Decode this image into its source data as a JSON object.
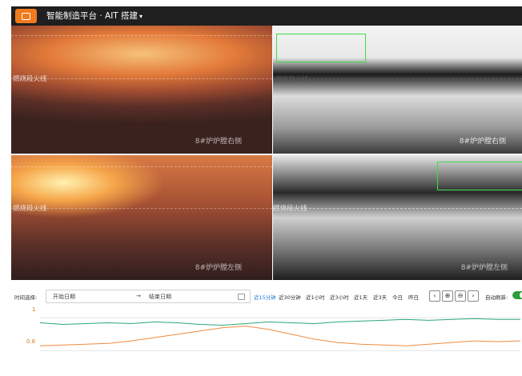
{
  "header": {
    "title": "智能制造平台 · AIT 搭建",
    "dropdown_caret": "▾",
    "logo_icon": "platform-logo"
  },
  "panels": {
    "top_left": {
      "zone_label": "燃烧段火线",
      "camera_label": "8#炉炉膛右侧"
    },
    "top_right": {
      "zone_label": "燃烧段火线",
      "camera_label": "8#炉炉膛右侧"
    },
    "bottom_left": {
      "zone_label": "燃烧段火线",
      "camera_label": "8#炉炉膛左侧"
    },
    "bottom_right": {
      "zone_label": "燃烧段火线",
      "camera_label": "8#炉炉膛左侧"
    }
  },
  "controls": {
    "time_label": "时间选择:",
    "start_placeholder": "开始日期",
    "arrow": "→",
    "end_placeholder": "结束日期",
    "quick_ranges": [
      "近15分钟",
      "近30分钟",
      "近1小时",
      "近3小时",
      "近1天",
      "近3天",
      "今日",
      "昨日"
    ],
    "active_range": "近15分钟",
    "prev_icon": "‹",
    "zoom_in_icon": "⊕",
    "zoom_out_icon": "⊖",
    "next_icon": "›",
    "auto_refresh_label": "自动刷新:",
    "auto_refresh_on": true
  },
  "chart_data": {
    "type": "line",
    "y_ticks": [
      "1",
      "0.8"
    ],
    "ylim": [
      0.7,
      1.05
    ],
    "series": [
      {
        "color": "#2aa876",
        "values": [
          0.97,
          0.96,
          0.965,
          0.97,
          0.965,
          0.975,
          0.97,
          0.96,
          0.955,
          0.965,
          0.975,
          0.97,
          0.965,
          0.975,
          0.98,
          0.985,
          0.99,
          0.985,
          0.99,
          0.995,
          0.99,
          0.99
        ]
      },
      {
        "color": "#f08a3c",
        "values": [
          0.83,
          0.835,
          0.84,
          0.845,
          0.86,
          0.88,
          0.9,
          0.92,
          0.94,
          0.95,
          0.93,
          0.9,
          0.87,
          0.85,
          0.84,
          0.835,
          0.83,
          0.84,
          0.85,
          0.86,
          0.855,
          0.86
        ]
      }
    ],
    "grid_color": "#e6e6e6"
  }
}
